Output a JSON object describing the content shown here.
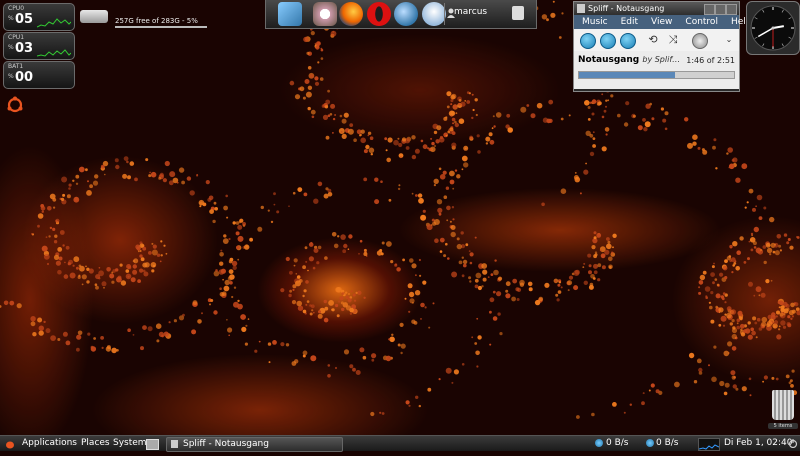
{
  "gauges": [
    {
      "label": "CPU0",
      "unit": "%",
      "value": "05"
    },
    {
      "label": "CPU1",
      "unit": "%",
      "value": "03"
    },
    {
      "label": "BAT1",
      "unit": "%",
      "value": "00"
    }
  ],
  "disk": {
    "text": "257G free of 283G - 5%"
  },
  "dock": {
    "user": "marcus",
    "icons": [
      "screen-icon",
      "screenlets-icon",
      "firefox-icon",
      "opera-icon",
      "thunderbird-icon",
      "email-client-icon",
      "user-icon",
      "lock-icon"
    ]
  },
  "player": {
    "title": "Spliff - Notausgang",
    "menu": [
      "Music",
      "Edit",
      "View",
      "Control",
      "Help"
    ],
    "track": "Notausgang",
    "artist": "by Splif…",
    "time": "1:46 of 2:51",
    "progress": 0.62
  },
  "clock": {
    "hour": 2,
    "minute": 40,
    "second": 30
  },
  "trash": {
    "label": "5 items"
  },
  "panel": {
    "applications": "Applications",
    "places": "Places",
    "system": "System",
    "task": "Spliff - Notausgang",
    "net_down": "0 B/s",
    "net_up": "0 B/s",
    "datetime": "Di Feb 1, 02:40"
  },
  "colors": {
    "menubar": "#46617e",
    "accent": "#1a7fb5",
    "background": "#1a0402"
  }
}
